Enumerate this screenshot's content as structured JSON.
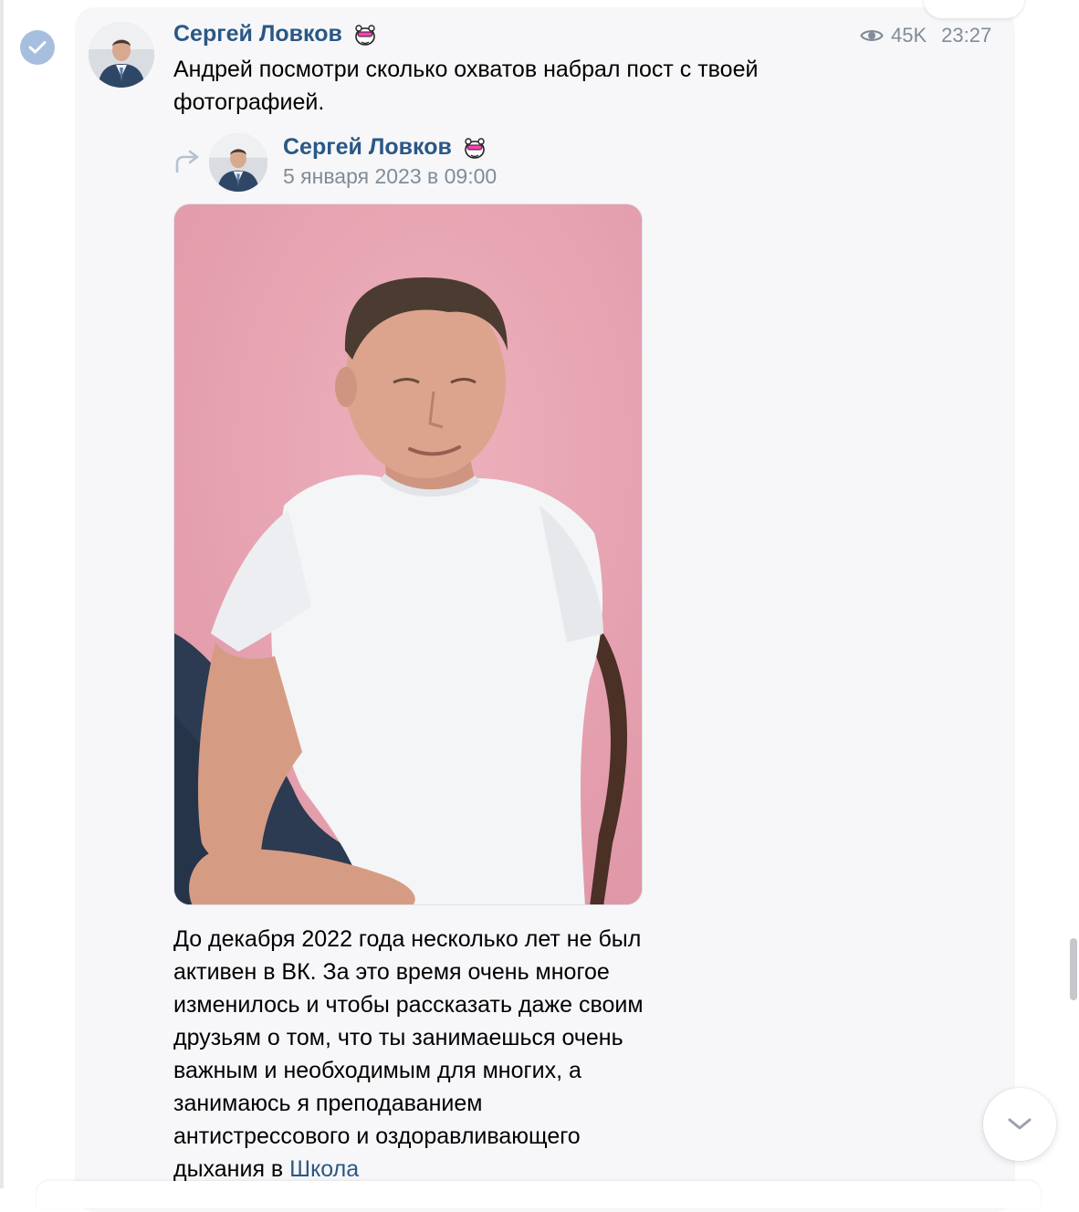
{
  "message": {
    "author": "Сергей Ловков",
    "views": "45K",
    "time": "23:27",
    "text": "Андрей посмотри сколько охватов набрал пост с твоей фотографией."
  },
  "repost": {
    "author": "Сергей Ловков",
    "date": "5 января 2023 в 09:00",
    "text": "До декабря 2022 года несколько лет не был активен в ВК. За это время очень многое изменилось и чтобы рассказать даже своим друзьям о том, что ты занимаешься очень важным и необходимым для многих, а занимаюсь я преподаванием антистрессового и оздоравливающего дыхания в ",
    "link_text": "Школа"
  },
  "icons": {
    "select": "check-circle-icon",
    "views": "eye-icon",
    "repost": "repost-arrow-icon",
    "scroll": "chevron-down-icon",
    "badge": "animal-badge-icon"
  },
  "colors": {
    "link": "#2a5885",
    "meta": "#818c99",
    "check": "#a6bfdf",
    "photo_bg": "#e8a3b0"
  }
}
